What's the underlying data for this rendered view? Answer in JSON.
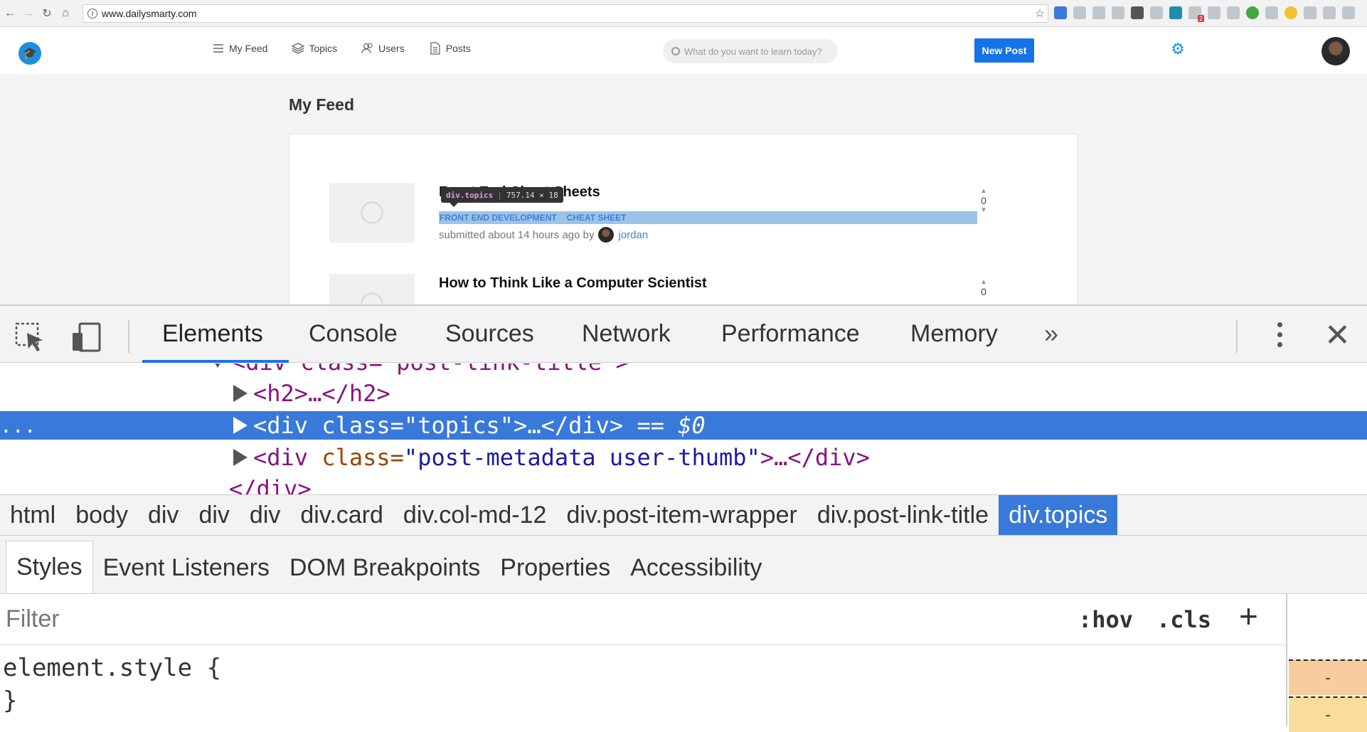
{
  "browser": {
    "url": "www.dailysmarty.com"
  },
  "site": {
    "nav": [
      {
        "label": "My Feed",
        "icon": "list-icon"
      },
      {
        "label": "Topics",
        "icon": "layers-icon"
      },
      {
        "label": "Users",
        "icon": "users-icon"
      },
      {
        "label": "Posts",
        "icon": "document-icon"
      }
    ],
    "search_placeholder": "What do you want to learn today?",
    "new_post_label": "New Post",
    "feed_title": "My Feed",
    "posts": [
      {
        "title": "Front End Cheat Sheets",
        "topics": [
          "FRONT END DEVELOPMENT",
          "CHEAT SHEET"
        ],
        "submitted": "submitted about 14 hours ago by",
        "author": "jordan",
        "votes": "0"
      },
      {
        "title": "How to Think Like a Computer Scientist",
        "votes": "0"
      }
    ],
    "tooltip": {
      "selector": "div.topics",
      "size": "757.14 × 18"
    }
  },
  "devtools": {
    "tabs": [
      "Elements",
      "Console",
      "Sources",
      "Network",
      "Performance",
      "Memory"
    ],
    "more_label": "»",
    "dom_lines": {
      "open_line": "<div class=\"post-link-title\">",
      "h2_line": "<h2>…</h2>",
      "selected_tag": "<div",
      "selected_attr": " class=",
      "selected_val": "\"topics\"",
      "selected_rest": ">…</div>",
      "selected_eq": " == $0",
      "meta_tag": "<div",
      "meta_attr": " class=",
      "meta_val": "\"post-metadata user-thumb\"",
      "meta_rest": ">…</div>",
      "close_line": "</div>",
      "gutter": "..."
    },
    "breadcrumbs": [
      "html",
      "body",
      "div",
      "div",
      "div",
      "div.card",
      "div.col-md-12",
      "div.post-item-wrapper",
      "div.post-link-title",
      "div.topics"
    ],
    "subtabs": [
      "Styles",
      "Event Listeners",
      "DOM Breakpoints",
      "Properties",
      "Accessibility"
    ],
    "filter_placeholder": "Filter",
    "hov_label": ":hov",
    "cls_label": ".cls",
    "add_label": "+",
    "rule_open": "element.style {",
    "rule_close": "}",
    "boxmodel": [
      "-",
      "-"
    ]
  }
}
